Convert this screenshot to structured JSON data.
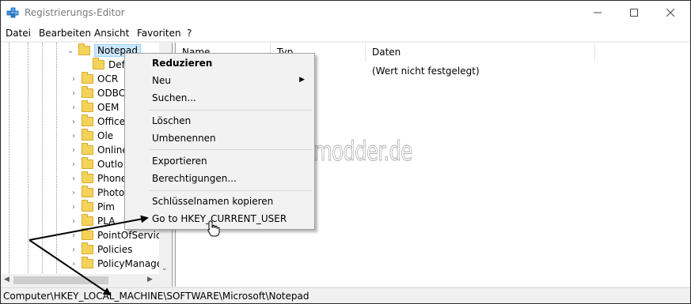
{
  "window": {
    "title": "Registrierungs-Editor",
    "icon": "regedit-icon",
    "controls": [
      "minimize",
      "maximize",
      "close"
    ]
  },
  "menubar": [
    "Datei",
    "Bearbeiten",
    "Ansicht",
    "Favoriten",
    "?"
  ],
  "tree": {
    "selected": {
      "label": "Notepad",
      "expanded": true
    },
    "child": {
      "label": "Def"
    },
    "items": [
      {
        "label": "OCR"
      },
      {
        "label": "ODBC"
      },
      {
        "label": "OEM"
      },
      {
        "label": "Office"
      },
      {
        "label": "Ole"
      },
      {
        "label": "Online"
      },
      {
        "label": "Outlo"
      },
      {
        "label": "Phone"
      },
      {
        "label": "Photos"
      },
      {
        "label": "Pim"
      },
      {
        "label": "PLA"
      },
      {
        "label": "PointOfService"
      },
      {
        "label": "Policies"
      },
      {
        "label": "PolicyManage"
      }
    ]
  },
  "list": {
    "columns": [
      "Name",
      "Typ",
      "Daten"
    ],
    "rows": [
      {
        "daten": "(Wert nicht festgelegt)"
      }
    ]
  },
  "context_menu": {
    "items": [
      {
        "label": "Reduzieren",
        "bold": true
      },
      {
        "label": "Neu",
        "submenu": true
      },
      {
        "label": "Suchen..."
      },
      {
        "label": "Löschen"
      },
      {
        "label": "Umbenennen"
      },
      {
        "label": "Exportieren"
      },
      {
        "label": "Berechtigungen..."
      },
      {
        "label": "Schlüsselnamen kopieren"
      },
      {
        "label": "Go to HKEY_CURRENT_USER"
      }
    ]
  },
  "watermark": "Deskmodder.de",
  "statusbar": {
    "path": "Computer\\HKEY_LOCAL_MACHINE\\SOFTWARE\\Microsoft\\Notepad"
  },
  "colors": {
    "selection": "#cce8ff",
    "folder": "#f5d35a"
  }
}
